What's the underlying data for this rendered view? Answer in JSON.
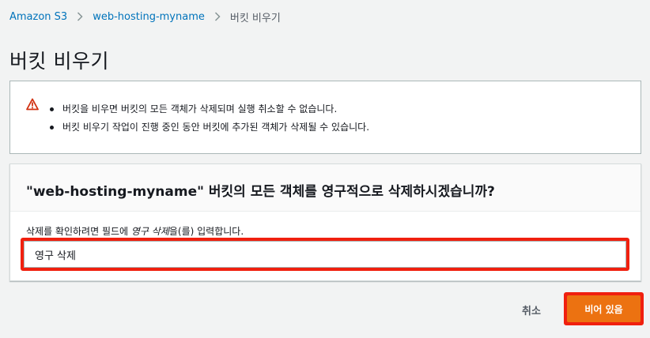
{
  "breadcrumb": {
    "items": [
      "Amazon S3",
      "web-hosting-myname"
    ],
    "current": "버킷 비우기"
  },
  "page": {
    "title": "버킷 비우기"
  },
  "warning": {
    "icon": "warning-icon",
    "items": [
      "버킷을 비우면 버킷의 모든 객체가 삭제되며 실행 취소할 수 없습니다.",
      "버킷 비우기 작업이 진행 중인 동안 버킷에 추가된 객체가 삭제될 수 있습니다."
    ]
  },
  "confirm": {
    "heading": "\"web-hosting-myname\" 버킷의 모든 객체를 영구적으로 삭제하시겠습니까?",
    "label_prefix": "삭제를 확인하려면 필드에 ",
    "label_em": "영구 삭제",
    "label_suffix": "을(를) 입력합니다.",
    "input_value": "영구 삭제"
  },
  "actions": {
    "cancel_label": "취소",
    "empty_label": "비어 있음"
  },
  "colors": {
    "link": "#0073bb",
    "primary": "#ec7211",
    "highlight": "#f0200f",
    "warning_icon": "#d13212"
  }
}
